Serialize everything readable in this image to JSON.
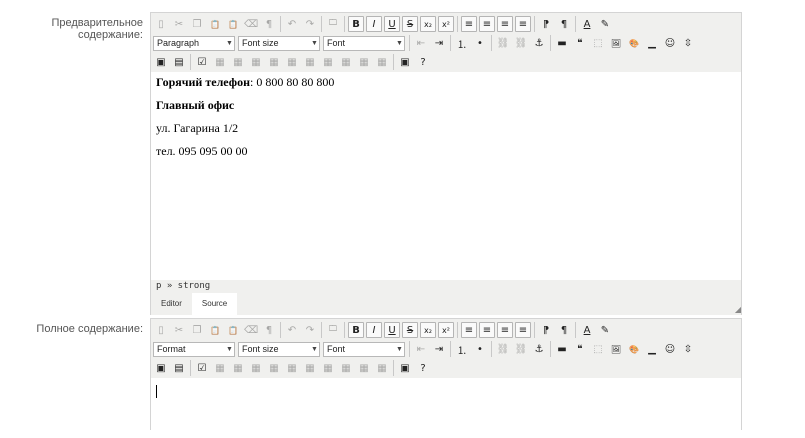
{
  "fields": [
    {
      "label": "Предварительное содержание:",
      "format_select": "Paragraph",
      "font_size_select": "Font size",
      "font_select": "Font",
      "content_lines": [
        {
          "bold": "Горячий телефон",
          "text": ": 0 800 80 80 800"
        },
        {
          "bold": "Главный офис",
          "text": ""
        },
        {
          "bold": "",
          "text": "ул. Гагарина 1/2"
        },
        {
          "bold": "",
          "text": "тел. 095 095 00 00"
        }
      ],
      "path": "p » strong",
      "tabs": [
        "Editor",
        "Source"
      ]
    },
    {
      "label": "Полное содержание:",
      "format_select": "Format",
      "font_size_select": "Font size",
      "font_select": "Font"
    }
  ],
  "toolbar": {
    "row1": [
      {
        "icon": "new-doc-icon",
        "glyph": "▯",
        "dis": true
      },
      {
        "icon": "cut-icon",
        "glyph": "✂",
        "dis": true
      },
      {
        "icon": "copy-icon",
        "glyph": "❐",
        "dis": true
      },
      {
        "icon": "paste-icon",
        "glyph": "📋"
      },
      {
        "icon": "paste-text-icon",
        "glyph": "📋"
      },
      {
        "icon": "clear-format-icon",
        "glyph": "⌫",
        "dis": true
      },
      {
        "icon": "paragraph-icon",
        "glyph": "¶",
        "dis": true
      },
      {
        "sep": true
      },
      {
        "icon": "undo-icon",
        "glyph": "↶",
        "dis": true
      },
      {
        "icon": "redo-icon",
        "glyph": "↷",
        "dis": true
      },
      {
        "sep": true
      },
      {
        "icon": "folder-icon",
        "glyph": "🗀"
      },
      {
        "sep": true
      },
      {
        "icon": "bold-icon",
        "glyph": "B",
        "framed": true,
        "bold": true
      },
      {
        "icon": "italic-icon",
        "glyph": "I",
        "framed": true,
        "italic": true
      },
      {
        "icon": "underline-icon",
        "glyph": "U",
        "framed": true,
        "underline": true
      },
      {
        "icon": "strikethrough-icon",
        "glyph": "S",
        "framed": true,
        "strike": true
      },
      {
        "icon": "subscript-icon",
        "glyph": "x₂",
        "framed": true
      },
      {
        "icon": "superscript-icon",
        "glyph": "x²",
        "framed": true
      },
      {
        "sep": true
      },
      {
        "icon": "align-left-icon",
        "glyph": "≡",
        "framed": true
      },
      {
        "icon": "align-center-icon",
        "glyph": "≡",
        "framed": true
      },
      {
        "icon": "align-right-icon",
        "glyph": "≡",
        "framed": true
      },
      {
        "icon": "align-justify-icon",
        "glyph": "≡",
        "framed": true
      },
      {
        "sep": true
      },
      {
        "icon": "ltr-icon",
        "glyph": "⁋"
      },
      {
        "icon": "rtl-icon",
        "glyph": "¶"
      },
      {
        "sep": true
      },
      {
        "icon": "text-color-icon",
        "glyph": "A",
        "underline": true
      },
      {
        "icon": "highlight-icon",
        "glyph": "✎"
      }
    ],
    "row2_after": [
      {
        "icon": "outdent-icon",
        "glyph": "⇤",
        "dis": true
      },
      {
        "icon": "indent-icon",
        "glyph": "⇥"
      },
      {
        "sep": true
      },
      {
        "icon": "ordered-list-icon",
        "glyph": "⒈"
      },
      {
        "icon": "unordered-list-icon",
        "glyph": "•"
      },
      {
        "sep": true
      },
      {
        "icon": "link-icon",
        "glyph": "⛓",
        "dis": true
      },
      {
        "icon": "unlink-icon",
        "glyph": "⛓",
        "dis": true
      },
      {
        "icon": "anchor-icon",
        "glyph": "⚓"
      },
      {
        "sep": true
      },
      {
        "icon": "horizontal-rule-icon",
        "glyph": "▬"
      },
      {
        "icon": "blockquote-icon",
        "glyph": "❝"
      },
      {
        "icon": "fullscreen-icon",
        "glyph": "⬚",
        "dis": true
      },
      {
        "icon": "image-icon",
        "glyph": "🖼"
      },
      {
        "icon": "paint-icon",
        "glyph": "🎨"
      },
      {
        "icon": "special-char-icon",
        "glyph": "▁"
      },
      {
        "icon": "emoticon-icon",
        "glyph": "☺"
      },
      {
        "icon": "page-break-icon",
        "glyph": "⇳"
      }
    ],
    "row3": [
      {
        "icon": "media-icon",
        "glyph": "▣"
      },
      {
        "icon": "film-icon",
        "glyph": "▤"
      },
      {
        "sep": true
      },
      {
        "icon": "table-icon",
        "glyph": "☑"
      },
      {
        "icon": "table-row-props-icon",
        "glyph": "▦",
        "dis": true
      },
      {
        "icon": "table-cell-props-icon",
        "glyph": "▦",
        "dis": true
      },
      {
        "icon": "insert-row-before-icon",
        "glyph": "▦",
        "dis": true
      },
      {
        "icon": "insert-row-after-icon",
        "glyph": "▦",
        "dis": true
      },
      {
        "icon": "delete-row-icon",
        "glyph": "▦",
        "dis": true
      },
      {
        "icon": "insert-col-before-icon",
        "glyph": "▦",
        "dis": true
      },
      {
        "icon": "insert-col-after-icon",
        "glyph": "▦",
        "dis": true
      },
      {
        "icon": "delete-col-icon",
        "glyph": "▦",
        "dis": true
      },
      {
        "icon": "split-cells-icon",
        "glyph": "▦",
        "dis": true
      },
      {
        "icon": "merge-cells-icon",
        "glyph": "▦",
        "dis": true
      },
      {
        "sep": true
      },
      {
        "icon": "visual-aid-icon",
        "glyph": "▣"
      },
      {
        "icon": "help-icon",
        "glyph": "?"
      }
    ]
  }
}
